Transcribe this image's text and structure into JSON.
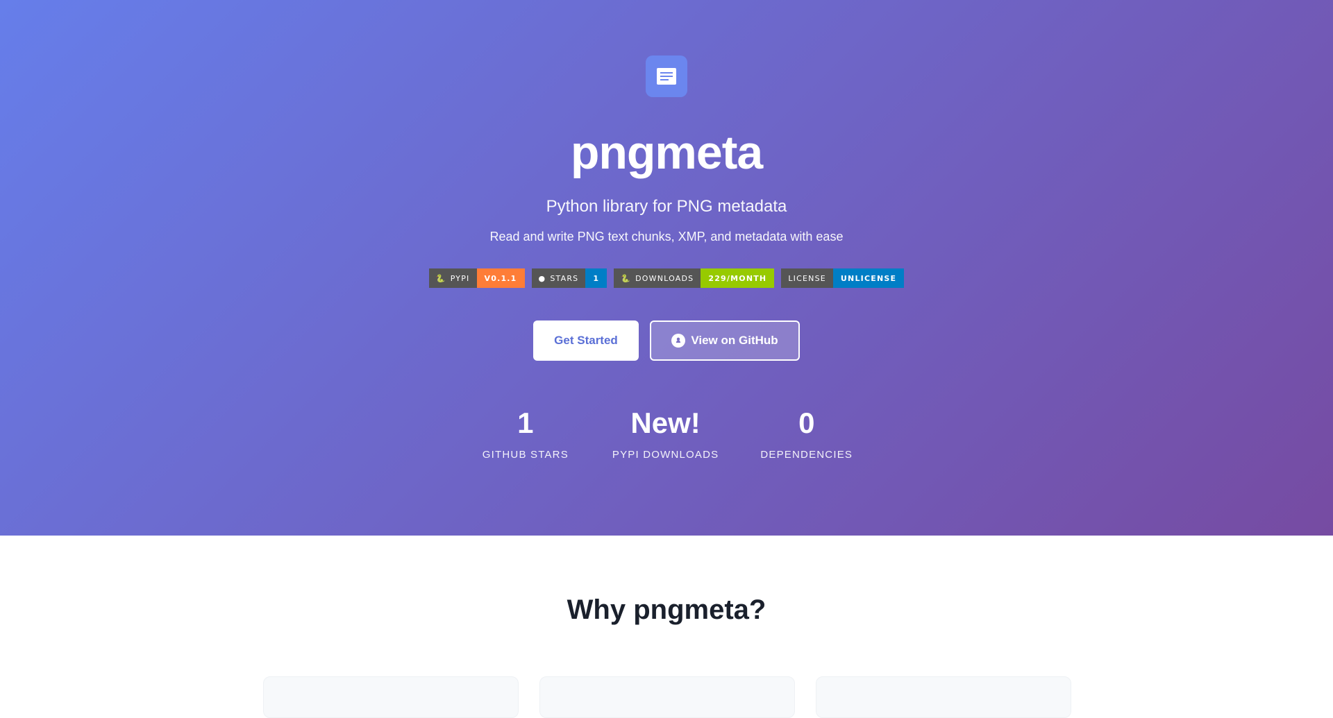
{
  "hero": {
    "title": "pngmeta",
    "subtitle": "Python library for PNG metadata",
    "tagline": "Read and write PNG text chunks, XMP, and metadata with ease",
    "logo_icon": "document-icon"
  },
  "badges": [
    {
      "label": "pypi",
      "value": "v0.1.1",
      "color": "#fe7d37",
      "icon": "python-icon"
    },
    {
      "label": "stars",
      "value": "1",
      "color": "#007ec6",
      "icon": "github-icon"
    },
    {
      "label": "downloads",
      "value": "229/month",
      "color": "#97ca00",
      "icon": "python-icon"
    },
    {
      "label": "license",
      "value": "Unlicense",
      "color": "#007ec6",
      "icon": ""
    }
  ],
  "buttons": {
    "primary": "Get Started",
    "secondary": "View on GitHub"
  },
  "stats": [
    {
      "value": "1",
      "label": "GitHub Stars"
    },
    {
      "value": "New!",
      "label": "PyPI Downloads"
    },
    {
      "value": "0",
      "label": "Dependencies"
    }
  ],
  "features": {
    "heading": "Why pngmeta?"
  },
  "colors": {
    "gradient_start": "#667eea",
    "gradient_end": "#764ba2",
    "badge_label_bg": "#555555"
  }
}
